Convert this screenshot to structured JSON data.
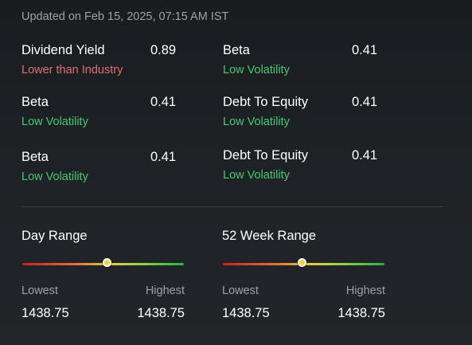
{
  "updated_text": "Updated on Feb 15, 2025, 07:15 AM IST",
  "colors": {
    "negative": "#e0706b",
    "positive": "#4cc86f"
  },
  "metrics": [
    {
      "label": "Dividend Yield",
      "value": "0.89",
      "note": "Lower than Industry",
      "tone": "negative"
    },
    {
      "label": "Beta",
      "value": "0.41",
      "note": "Low Volatility",
      "tone": "positive"
    },
    {
      "label": "Beta",
      "value": "0.41",
      "note": "Low Volatility",
      "tone": "positive"
    },
    {
      "label": "Debt To Equity",
      "value": "0.41",
      "note": "Low Volatility",
      "tone": "positive"
    },
    {
      "label": "Beta",
      "value": "0.41",
      "note": "Low Volatility",
      "tone": "positive"
    },
    {
      "label": "Debt To Equity",
      "value": "0.41",
      "note": "Low Volatility",
      "tone": "positive"
    }
  ],
  "ranges": [
    {
      "title": "Day Range",
      "low_label": "Lowest",
      "high_label": "Highest",
      "low_value": "1438.75",
      "high_value": "1438.75",
      "marker_fraction": 0.52
    },
    {
      "title": "52 Week Range",
      "low_label": "Lowest",
      "high_label": "Highest",
      "low_value": "1438.75",
      "high_value": "1438.75",
      "marker_fraction": 0.49
    }
  ]
}
